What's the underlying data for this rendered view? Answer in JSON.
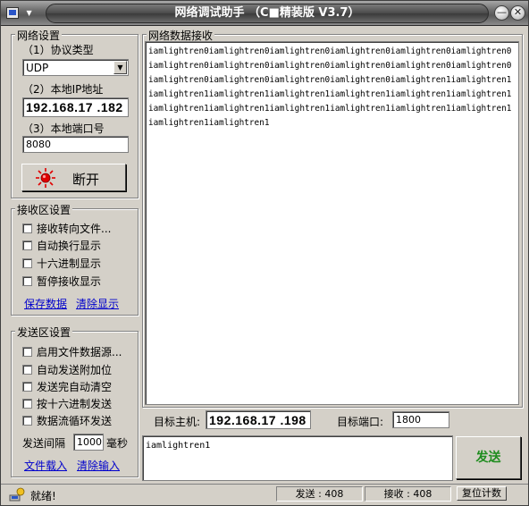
{
  "window": {
    "title": "网络调试助手 （C■精装版 V3.7）",
    "minimize_glyph": "—",
    "maximize_glyph": "□",
    "close_glyph": "✕"
  },
  "network_settings": {
    "title": "网络设置",
    "protocol_label": "（1）协议类型",
    "protocol_value": "UDP",
    "local_ip_label": "（2）本地IP地址",
    "local_ip_value": "192.168.17 .182",
    "local_port_label": "（3）本地端口号",
    "local_port_value": "8080",
    "connect_button_label": "断开",
    "status_color": "#e00000"
  },
  "receive_settings": {
    "title": "接收区设置",
    "options": [
      "接收转向文件...",
      "自动换行显示",
      "十六进制显示",
      "暂停接收显示"
    ],
    "save_link": "保存数据",
    "clear_link": "清除显示"
  },
  "send_settings": {
    "title": "发送区设置",
    "options": [
      "启用文件数据源...",
      "自动发送附加位",
      "发送完自动清空",
      "按十六进制发送",
      "数据流循环发送"
    ],
    "interval_label": "发送间隔",
    "interval_value": "1000",
    "interval_unit": "毫秒",
    "load_file_link": "文件载入",
    "clear_input_link": "清除输入"
  },
  "receive_area": {
    "title": "网络数据接收",
    "content": "iamlightren0iamlightren0iamlightren0iamlightren0iamlightren0iamlightren0iamlightren0iamlightren0iamlightren0iamlightren0iamlightren0iamlightren0iamlightren0iamlightren0iamlightren0iamlightren0iamlightren1iamlightren1iamlightren1iamlightren1iamlightren1iamlightren1iamlightren1iamlightren1iamlightren1iamlightren1iamlightren1iamlightren1iamlightren1iamlightren1iamlightren1iamlightren1"
  },
  "target": {
    "host_label": "目标主机:",
    "host_value": "192.168.17 .198",
    "port_label": "目标端口:",
    "port_value": "1800"
  },
  "send_area": {
    "content": "iamlightren1",
    "send_button_label": "发送",
    "send_button_color": "#1e8c1e"
  },
  "statusbar": {
    "status_text": "就绪!",
    "sent_label": "发送 : 408",
    "received_label": "接收 : 408",
    "reset_button_label": "复位计数"
  }
}
